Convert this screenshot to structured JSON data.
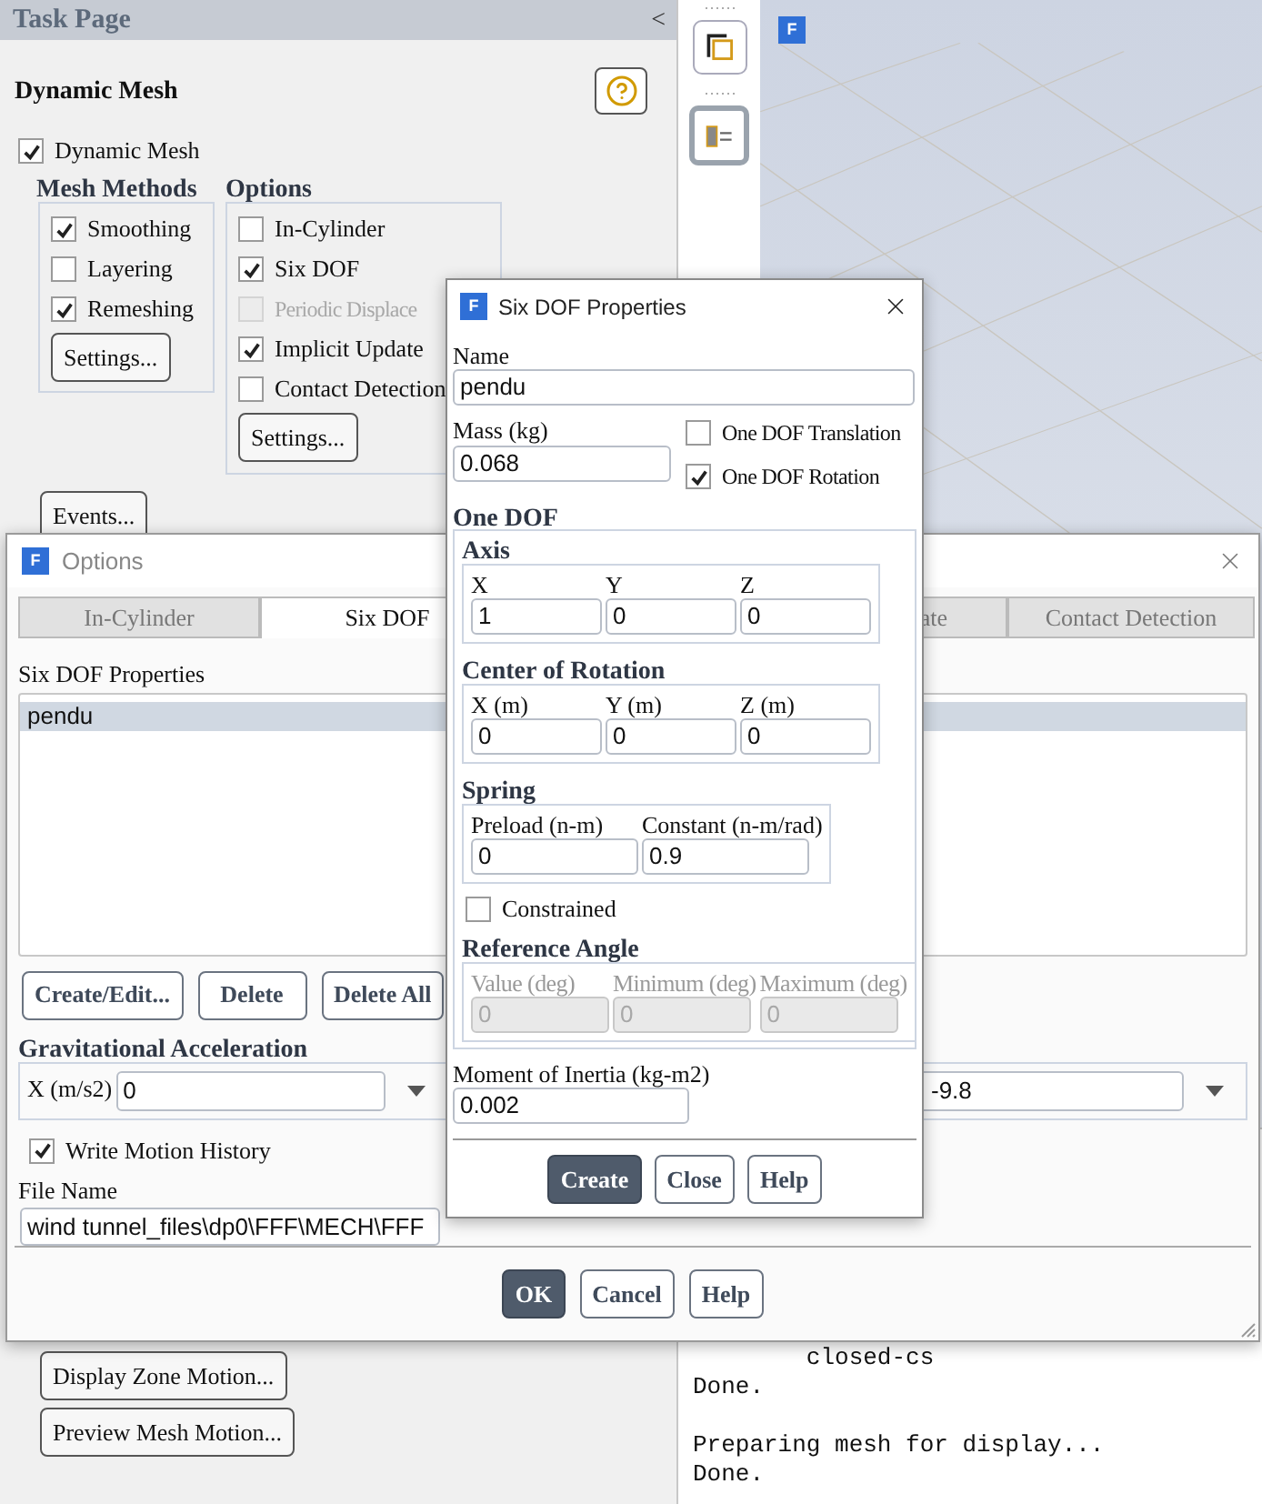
{
  "task_page": {
    "header": "Task Page",
    "collapse": "<",
    "title": "Dynamic Mesh",
    "dynamic_mesh": {
      "label": "Dynamic Mesh",
      "checked": true
    },
    "mesh_methods": {
      "title": "Mesh Methods",
      "items": [
        {
          "label": "Smoothing",
          "checked": true
        },
        {
          "label": "Layering",
          "checked": false
        },
        {
          "label": "Remeshing",
          "checked": true
        }
      ],
      "button": "Settings..."
    },
    "options": {
      "title": "Options",
      "items": [
        {
          "label": "In-Cylinder",
          "checked": false,
          "disabled": false
        },
        {
          "label": "Six DOF",
          "checked": true,
          "disabled": false
        },
        {
          "label": "Periodic Displace",
          "checked": false,
          "disabled": true
        },
        {
          "label": "Implicit Update",
          "checked": true,
          "disabled": false
        },
        {
          "label": "Contact Detection",
          "checked": false,
          "disabled": false
        }
      ],
      "button": "Settings..."
    },
    "top_button": "Events...",
    "bottom_buttons": [
      "Display Zone Motion...",
      "Preview Mesh Motion..."
    ]
  },
  "viewport": {
    "logo": "F"
  },
  "console": {
    "blocks": [
      [
        "        closed-cs",
        "Done."
      ],
      [
        "Preparing mesh for display...",
        "Done."
      ]
    ]
  },
  "options_dialog": {
    "icon": "F",
    "title": "Options",
    "tabs": [
      {
        "label": "In-Cylinder",
        "selected": false
      },
      {
        "label": "Six DOF",
        "selected": true
      },
      {
        "label": "ate",
        "selected": false
      },
      {
        "label": "Contact Detection",
        "selected": false
      }
    ],
    "properties_label": "Six DOF Properties",
    "properties": [
      {
        "name": "pendu",
        "selected": true
      }
    ],
    "list_buttons": [
      "Create/Edit...",
      "Delete",
      "Delete All"
    ],
    "gravity": {
      "title": "Gravitational Acceleration",
      "x_label": "X (m/s2)",
      "x_value": "0",
      "field_2_value": "-9.8"
    },
    "write_motion_history": {
      "label": "Write Motion History",
      "checked": true
    },
    "file_name": {
      "label": "File Name",
      "value": "wind tunnel_files\\dp0\\FFF\\MECH\\FFF"
    },
    "footer_buttons": [
      {
        "label": "OK",
        "primary": true
      },
      {
        "label": "Cancel",
        "primary": false
      },
      {
        "label": "Help",
        "primary": false
      }
    ]
  },
  "six_dof_dialog": {
    "icon": "F",
    "title": "Six DOF Properties",
    "name_label": "Name",
    "name_value": "pendu",
    "mass_label": "Mass (kg)",
    "mass_value": "0.068",
    "translation": {
      "label": "One DOF Translation",
      "checked": false
    },
    "rotation": {
      "label": "One DOF Rotation",
      "checked": true
    },
    "one_dof_title": "One DOF",
    "axis": {
      "title": "Axis",
      "fields": [
        {
          "label": "X",
          "value": "1"
        },
        {
          "label": "Y",
          "value": "0"
        },
        {
          "label": "Z",
          "value": "0"
        }
      ]
    },
    "center": {
      "title": "Center of Rotation",
      "fields": [
        {
          "label": "X (m)",
          "value": "0"
        },
        {
          "label": "Y (m)",
          "value": "0"
        },
        {
          "label": "Z (m)",
          "value": "0"
        }
      ]
    },
    "spring": {
      "title": "Spring",
      "fields": [
        {
          "label": "Preload (n-m)",
          "value": "0"
        },
        {
          "label": "Constant (n-m/rad)",
          "value": "0.9"
        }
      ]
    },
    "constrained": {
      "label": "Constrained",
      "checked": false
    },
    "reference_angle": {
      "title": "Reference Angle",
      "disabled": true,
      "fields": [
        {
          "label": "Value (deg)",
          "value": "0"
        },
        {
          "label": "Minimum (deg)",
          "value": "0"
        },
        {
          "label": "Maximum (deg)",
          "value": "0"
        }
      ]
    },
    "inertia_label": "Moment of Inertia (kg-m2)",
    "inertia_value": "0.002",
    "buttons": [
      {
        "label": "Create",
        "primary": true
      },
      {
        "label": "Close",
        "primary": false
      },
      {
        "label": "Help",
        "primary": false
      }
    ]
  }
}
